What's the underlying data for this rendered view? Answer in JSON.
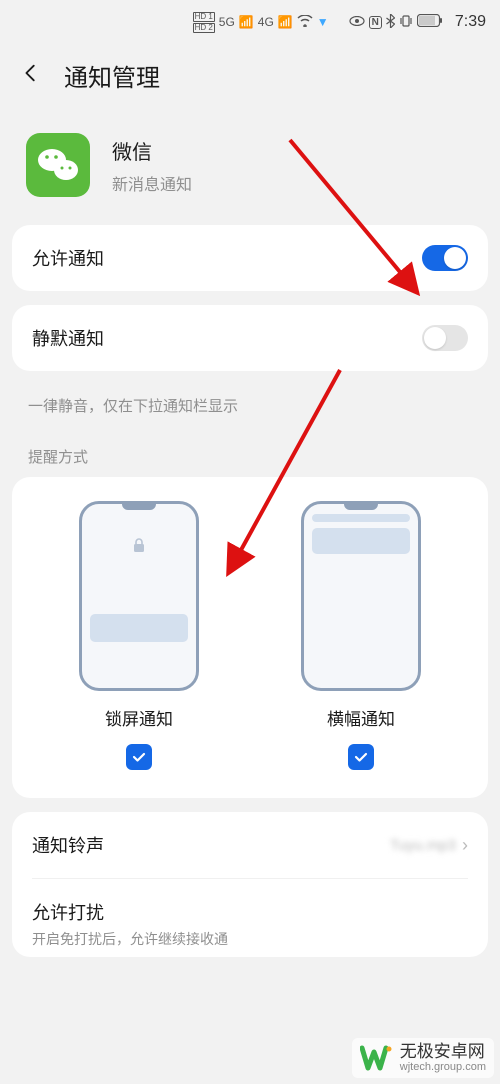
{
  "status": {
    "hd1": "HD 1",
    "hd2": "HD 2",
    "sig5g": "5G",
    "sig4g": "4G",
    "time": "7:39"
  },
  "header": {
    "title": "通知管理"
  },
  "app": {
    "name": "微信",
    "subtitle": "新消息通知"
  },
  "rows": {
    "allow": {
      "label": "允许通知",
      "on": true
    },
    "silent": {
      "label": "静默通知",
      "on": false
    },
    "silent_hint": "一律静音，仅在下拉通知栏显示",
    "mode_section": "提醒方式",
    "lock_label": "锁屏通知",
    "banner_label": "横幅通知",
    "ringtone": {
      "label": "通知铃声",
      "value": "Tuyu.mp3"
    },
    "dnd": {
      "label": "允许打扰",
      "sub": "开启免打扰后，允许继续接收通"
    }
  },
  "watermark": {
    "name": "无极安卓网",
    "url": "wjtech.group.com"
  }
}
